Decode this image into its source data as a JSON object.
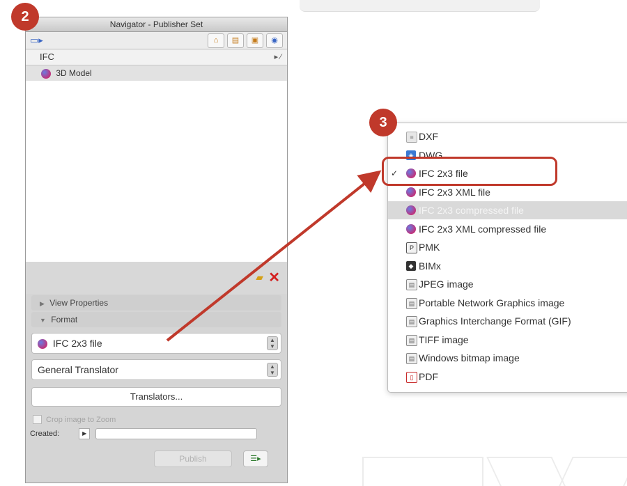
{
  "badges": {
    "left": "2",
    "right": "3"
  },
  "navigator": {
    "title": "Navigator - Publisher Set",
    "tree_header": "IFC",
    "tree_header_right": "▸ ⁄",
    "tree_item": "3D Model",
    "view_properties": "View Properties",
    "format_section": "Format",
    "format_value": "IFC 2x3 file",
    "translator_value": "General Translator",
    "translators_button": "Translators...",
    "crop_label": "Crop image to Zoom",
    "created_label": "Created:",
    "publish_button": "Publish"
  },
  "format_menu": {
    "items": [
      {
        "label": "DXF",
        "icon": "dxf-icon",
        "checked": false,
        "selected": false
      },
      {
        "label": "DWG",
        "icon": "dwg-icon",
        "checked": false,
        "selected": false
      },
      {
        "label": "IFC 2x3 file",
        "icon": "ifc-icon",
        "checked": true,
        "selected": false
      },
      {
        "label": "IFC 2x3 XML file",
        "icon": "ifc-icon",
        "checked": false,
        "selected": false
      },
      {
        "label": "IFC 2x3 compressed file",
        "icon": "ifc-icon",
        "checked": false,
        "selected": true
      },
      {
        "label": "IFC 2x3 XML compressed file",
        "icon": "ifc-icon",
        "checked": false,
        "selected": false
      },
      {
        "label": "PMK",
        "icon": "pmk-icon",
        "checked": false,
        "selected": false
      },
      {
        "label": "BIMx",
        "icon": "bimx-icon",
        "checked": false,
        "selected": false
      },
      {
        "label": "JPEG image",
        "icon": "image-icon",
        "checked": false,
        "selected": false
      },
      {
        "label": "Portable Network Graphics image",
        "icon": "image-icon",
        "checked": false,
        "selected": false
      },
      {
        "label": "Graphics Interchange Format (GIF)",
        "icon": "image-icon",
        "checked": false,
        "selected": false
      },
      {
        "label": "TIFF image",
        "icon": "image-icon",
        "checked": false,
        "selected": false
      },
      {
        "label": "Windows bitmap image",
        "icon": "image-icon",
        "checked": false,
        "selected": false
      },
      {
        "label": "PDF",
        "icon": "pdf-icon",
        "checked": false,
        "selected": false
      }
    ]
  },
  "colors": {
    "accent": "#c0392b"
  }
}
